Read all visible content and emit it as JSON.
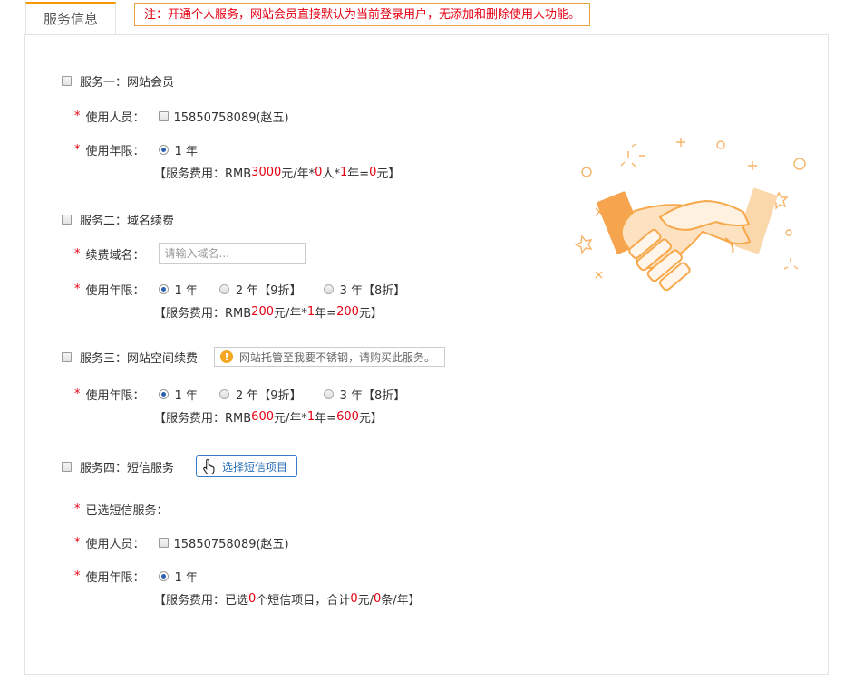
{
  "tab": {
    "label": "服务信息"
  },
  "notice": "注：开通个人服务，网站会员直接默认为当前登录用户，无添加和删除使用人功能。",
  "labels": {
    "required_mark": "*",
    "user": "使用人员：",
    "years": "使用年限：",
    "domain": "续费域名：",
    "selected_sms": "已选短信服务："
  },
  "member": "15850758089(赵五)",
  "service1": {
    "title": "服务一：网站会员",
    "options": [
      "1 年"
    ],
    "fee": {
      "prefix": "【服务费用：RMB ",
      "price": "3000",
      "unit1": " 元/年* ",
      "count": "0",
      "unit2": " 人* ",
      "years": "1",
      "unit3": " 年= ",
      "total": "0",
      "suffix": " 元】"
    }
  },
  "service2": {
    "title": "服务二：域名续费",
    "domain_placeholder": "请输入域名...",
    "options": [
      "1 年",
      "2 年【9折】",
      "3 年【8折】"
    ],
    "fee": {
      "prefix": "【服务费用：RMB ",
      "price": "200",
      "unit1": " 元/年* ",
      "years": "1",
      "unit3": " 年= ",
      "total": "200",
      "suffix": " 元】"
    }
  },
  "service3": {
    "title": "服务三：网站空间续费",
    "tip": "网站托管至我要不锈钢，请购买此服务。",
    "tip_icon": "!",
    "options": [
      "1 年",
      "2 年【9折】",
      "3 年【8折】"
    ],
    "fee": {
      "prefix": "【服务费用：RMB ",
      "price": "600",
      "unit1": " 元/年* ",
      "years": "1",
      "unit3": " 年= ",
      "total": "600",
      "suffix": " 元】"
    }
  },
  "service4": {
    "title": "服务四：短信服务",
    "button": "选择短信项目",
    "options": [
      "1 年"
    ],
    "fee": {
      "prefix": "【服务费用：已选 ",
      "count": "0",
      "mid": " 个短信项目，合计 ",
      "total": "0",
      "mid2": " 元/ ",
      "qty": "0",
      "suffix": " 条/年】"
    }
  },
  "colors": {
    "accent": "#f39800",
    "required": "#e60012",
    "link": "#2a6fb8",
    "illustration": "#f7a84a"
  },
  "icons": {
    "illustration": "handshake-illustration",
    "button_icon": "hand-pointer-icon",
    "tip_icon": "warning-icon"
  }
}
